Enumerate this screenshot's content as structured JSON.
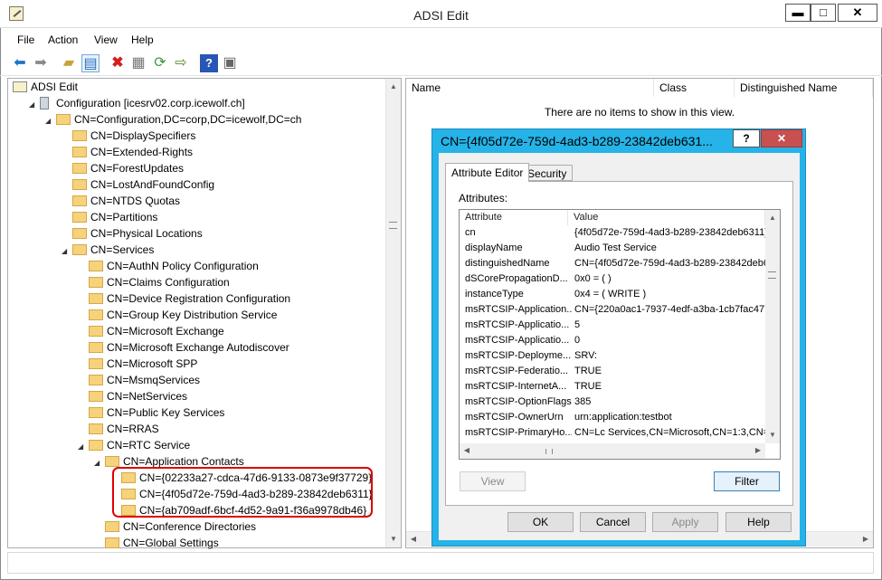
{
  "window": {
    "title": "ADSI Edit",
    "minimize": "▬",
    "maximize": "□",
    "close": "✕"
  },
  "menu": [
    "File",
    "Action",
    "View",
    "Help"
  ],
  "toolbar": [
    "back-arrow-icon",
    "forward-arrow-icon",
    "up-folder-icon",
    "show-tree-icon",
    "delete-icon",
    "properties-icon",
    "refresh-icon",
    "export-icon",
    "help-icon",
    "console-icon"
  ],
  "tree": {
    "root": "ADSI Edit",
    "items": [
      {
        "label": "Configuration [icesrv02.corp.icewolf.ch]",
        "level": 1,
        "expander": "◢",
        "icon": "server-icon"
      },
      {
        "label": "CN=Configuration,DC=corp,DC=icewolf,DC=ch",
        "level": 2,
        "expander": "◢",
        "icon": "folder-icon"
      },
      {
        "label": "CN=DisplaySpecifiers",
        "level": 3,
        "expander": "",
        "icon": "folder-icon"
      },
      {
        "label": "CN=Extended-Rights",
        "level": 3,
        "expander": "",
        "icon": "folder-icon"
      },
      {
        "label": "CN=ForestUpdates",
        "level": 3,
        "expander": "",
        "icon": "folder-icon"
      },
      {
        "label": "CN=LostAndFoundConfig",
        "level": 3,
        "expander": "",
        "icon": "folder-icon"
      },
      {
        "label": "CN=NTDS Quotas",
        "level": 3,
        "expander": "",
        "icon": "folder-icon"
      },
      {
        "label": "CN=Partitions",
        "level": 3,
        "expander": "",
        "icon": "folder-icon"
      },
      {
        "label": "CN=Physical Locations",
        "level": 3,
        "expander": "",
        "icon": "folder-icon"
      },
      {
        "label": "CN=Services",
        "level": 3,
        "expander": "◢",
        "icon": "folder-icon"
      },
      {
        "label": "CN=AuthN Policy Configuration",
        "level": 4,
        "expander": "",
        "icon": "folder-icon"
      },
      {
        "label": "CN=Claims Configuration",
        "level": 4,
        "expander": "",
        "icon": "folder-icon"
      },
      {
        "label": "CN=Device Registration Configuration",
        "level": 4,
        "expander": "",
        "icon": "folder-icon"
      },
      {
        "label": "CN=Group Key Distribution Service",
        "level": 4,
        "expander": "",
        "icon": "folder-icon"
      },
      {
        "label": "CN=Microsoft Exchange",
        "level": 4,
        "expander": "",
        "icon": "folder-icon"
      },
      {
        "label": "CN=Microsoft Exchange Autodiscover",
        "level": 4,
        "expander": "",
        "icon": "folder-icon"
      },
      {
        "label": "CN=Microsoft SPP",
        "level": 4,
        "expander": "",
        "icon": "folder-icon"
      },
      {
        "label": "CN=MsmqServices",
        "level": 4,
        "expander": "",
        "icon": "folder-icon"
      },
      {
        "label": "CN=NetServices",
        "level": 4,
        "expander": "",
        "icon": "folder-icon"
      },
      {
        "label": "CN=Public Key Services",
        "level": 4,
        "expander": "",
        "icon": "folder-icon"
      },
      {
        "label": "CN=RRAS",
        "level": 4,
        "expander": "",
        "icon": "folder-icon"
      },
      {
        "label": "CN=RTC Service",
        "level": 4,
        "expander": "◢",
        "icon": "folder-icon"
      },
      {
        "label": "CN=Application Contacts",
        "level": 5,
        "expander": "◢",
        "icon": "folder-icon"
      },
      {
        "label": "CN={02233a27-cdca-47d6-9133-0873e9f37729}",
        "level": 6,
        "expander": "",
        "icon": "folder-icon"
      },
      {
        "label": "CN={4f05d72e-759d-4ad3-b289-23842deb6311}",
        "level": 6,
        "expander": "",
        "icon": "folder-icon"
      },
      {
        "label": "CN={ab709adf-6bcf-4d52-9a91-f36a9978db46}",
        "level": 6,
        "expander": "",
        "icon": "folder-icon"
      },
      {
        "label": "CN=Conference Directories",
        "level": 5,
        "expander": "",
        "icon": "folder-icon"
      },
      {
        "label": "CN=Global Settings",
        "level": 5,
        "expander": "",
        "icon": "folder-icon"
      }
    ]
  },
  "list": {
    "columns": [
      "Name",
      "Class",
      "Distinguished Name"
    ],
    "empty": "There are no items to show in this view."
  },
  "dialog": {
    "title": "CN={4f05d72e-759d-4ad3-b289-23842deb631...",
    "help": "?",
    "close": "✕",
    "tabs": [
      "Attribute Editor",
      "Security"
    ],
    "attributes_label": "Attributes:",
    "columns": [
      "Attribute",
      "Value"
    ],
    "rows": [
      {
        "attr": "cn",
        "value": "{4f05d72e-759d-4ad3-b289-23842deb6311}"
      },
      {
        "attr": "displayName",
        "value": "Audio Test Service"
      },
      {
        "attr": "distinguishedName",
        "value": "CN={4f05d72e-759d-4ad3-b289-23842deb63"
      },
      {
        "attr": "dSCorePropagationD...",
        "value": "0x0 = ( )"
      },
      {
        "attr": "instanceType",
        "value": "0x4 = ( WRITE )"
      },
      {
        "attr": "msRTCSIP-Application...",
        "value": "CN={220a0ac1-7937-4edf-a3ba-1cb7fac477"
      },
      {
        "attr": "msRTCSIP-Applicatio...",
        "value": "5"
      },
      {
        "attr": "msRTCSIP-Applicatio...",
        "value": "0"
      },
      {
        "attr": "msRTCSIP-Deployme...",
        "value": "SRV:"
      },
      {
        "attr": "msRTCSIP-Federatio...",
        "value": "TRUE"
      },
      {
        "attr": "msRTCSIP-InternetA...",
        "value": "TRUE"
      },
      {
        "attr": "msRTCSIP-OptionFlags",
        "value": "385"
      },
      {
        "attr": "msRTCSIP-OwnerUrn",
        "value": "urn:application:testbot"
      },
      {
        "attr": "msRTCSIP-PrimaryHo...",
        "value": "CN=Lc Services,CN=Microsoft,CN=1:3,CN=P"
      }
    ],
    "view_button": "View",
    "filter_button": "Filter",
    "ok": "OK",
    "cancel": "Cancel",
    "apply": "Apply",
    "help_button": "Help"
  }
}
